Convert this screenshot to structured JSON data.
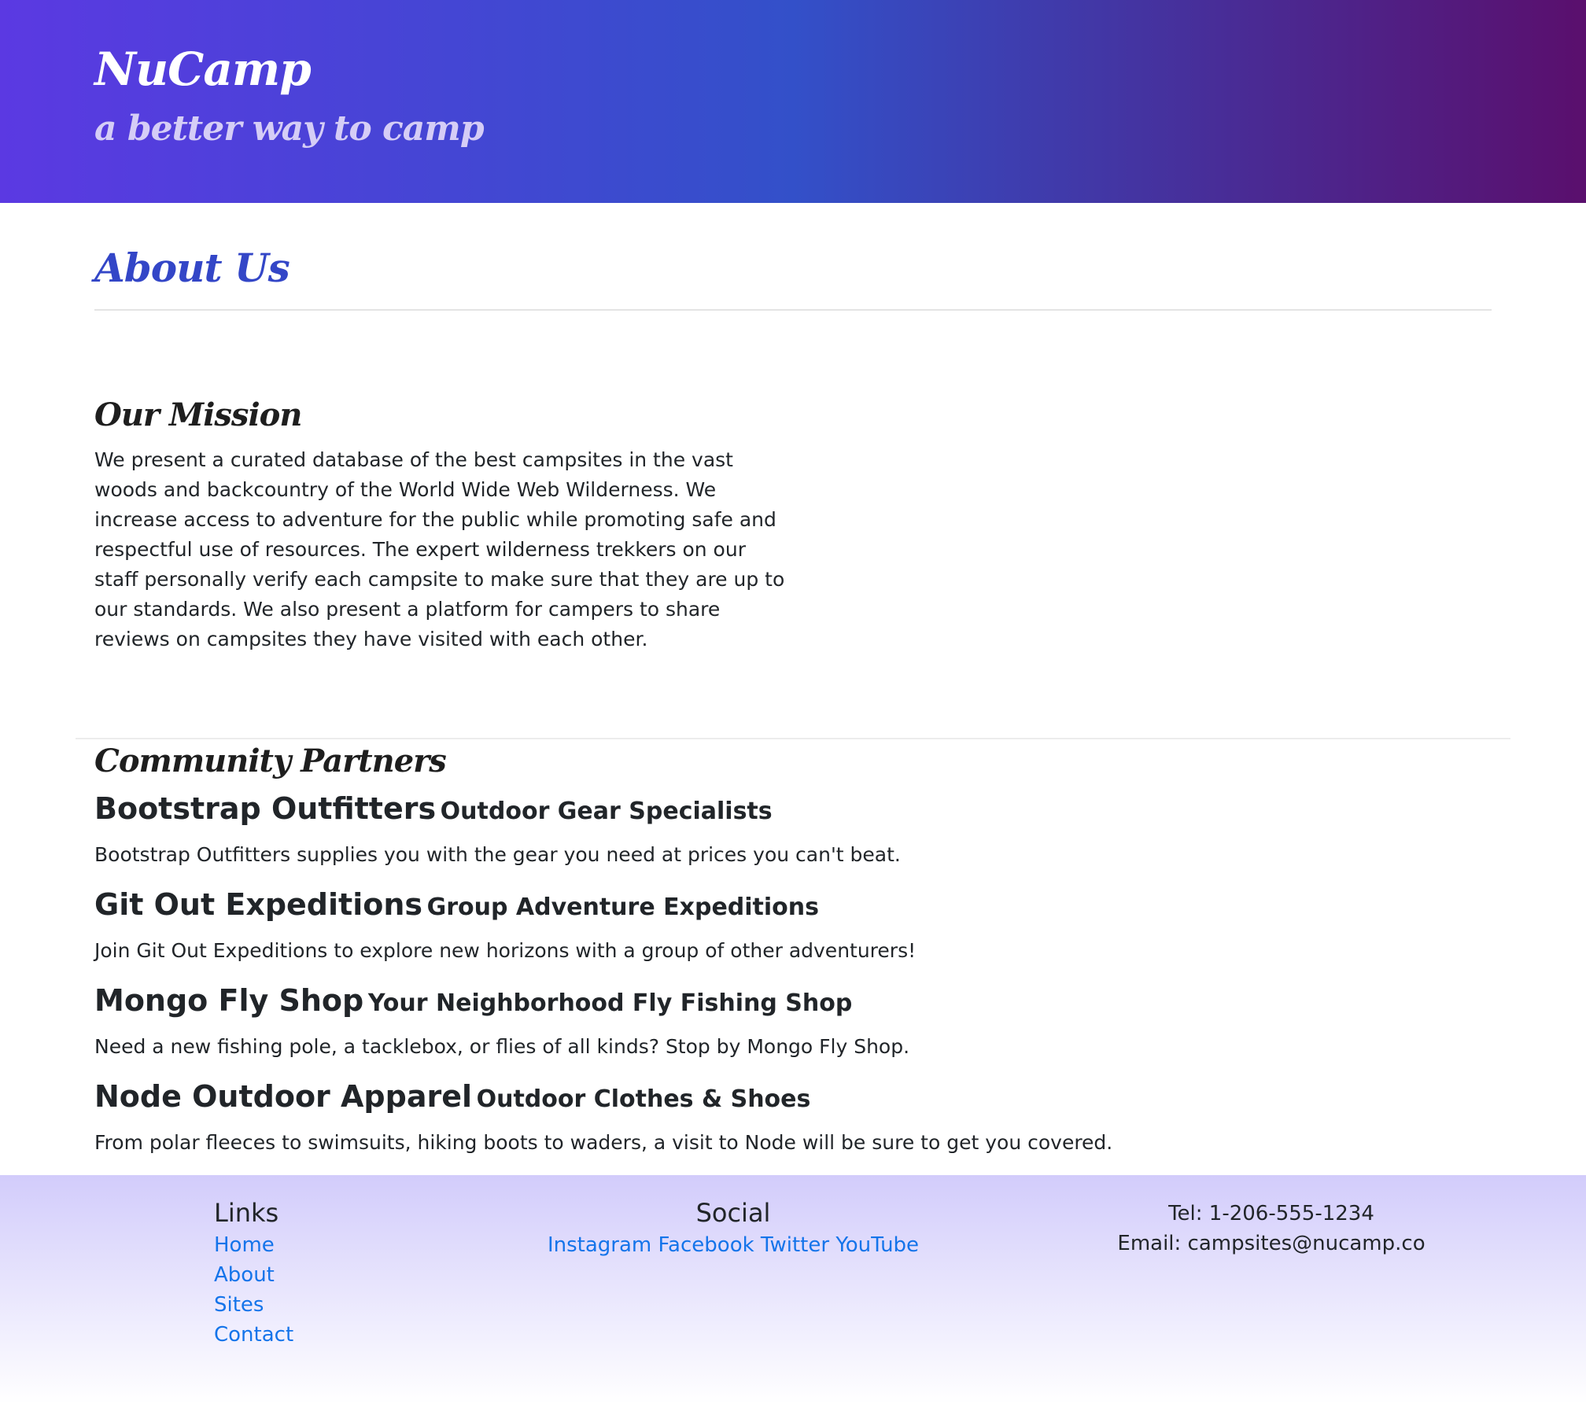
{
  "header": {
    "brand": "NuCamp",
    "tagline": "a better way to camp"
  },
  "page": {
    "title": "About Us"
  },
  "mission": {
    "heading": "Our Mission",
    "text": "We present a curated database of the best campsites in the vast woods and backcountry of the World Wide Web Wilderness. We increase access to adventure for the public while promoting safe and respectful use of resources. The expert wilderness trekkers on our staff personally verify each campsite to make sure that they are up to our standards. We also present a platform for campers to share reviews on campsites they have visited with each other."
  },
  "partners": {
    "heading": "Community Partners",
    "items": [
      {
        "name": "Bootstrap Outfitters",
        "tagline": "Outdoor Gear Specialists",
        "description": "Bootstrap Outfitters supplies you with the gear you need at prices you can't beat."
      },
      {
        "name": "Git Out Expeditions",
        "tagline": "Group Adventure Expeditions",
        "description": "Join Git Out Expeditions to explore new horizons with a group of other adventurers!"
      },
      {
        "name": "Mongo Fly Shop",
        "tagline": "Your Neighborhood Fly Fishing Shop",
        "description": "Need a new fishing pole, a tacklebox, or flies of all kinds? Stop by Mongo Fly Shop."
      },
      {
        "name": "Node Outdoor Apparel",
        "tagline": "Outdoor Clothes & Shoes",
        "description": "From polar fleeces to swimsuits, hiking boots to waders, a visit to Node will be sure to get you covered."
      }
    ]
  },
  "footer": {
    "links_heading": "Links",
    "links": [
      "Home",
      "About",
      "Sites",
      "Contact"
    ],
    "social_heading": "Social",
    "social": [
      "Instagram",
      "Facebook",
      "Twitter",
      "YouTube"
    ],
    "tel": "Tel: 1-206-555-1234",
    "email": "Email: campsites@nucamp.co"
  },
  "colors": {
    "header_gradient_start": "#5b39e2",
    "header_gradient_mid": "#3350c9",
    "header_gradient_end": "#5a0f6d",
    "title_blue": "#3346c7",
    "link_blue": "#1474ea",
    "footer_gradient_start": "#d2ccfb"
  }
}
